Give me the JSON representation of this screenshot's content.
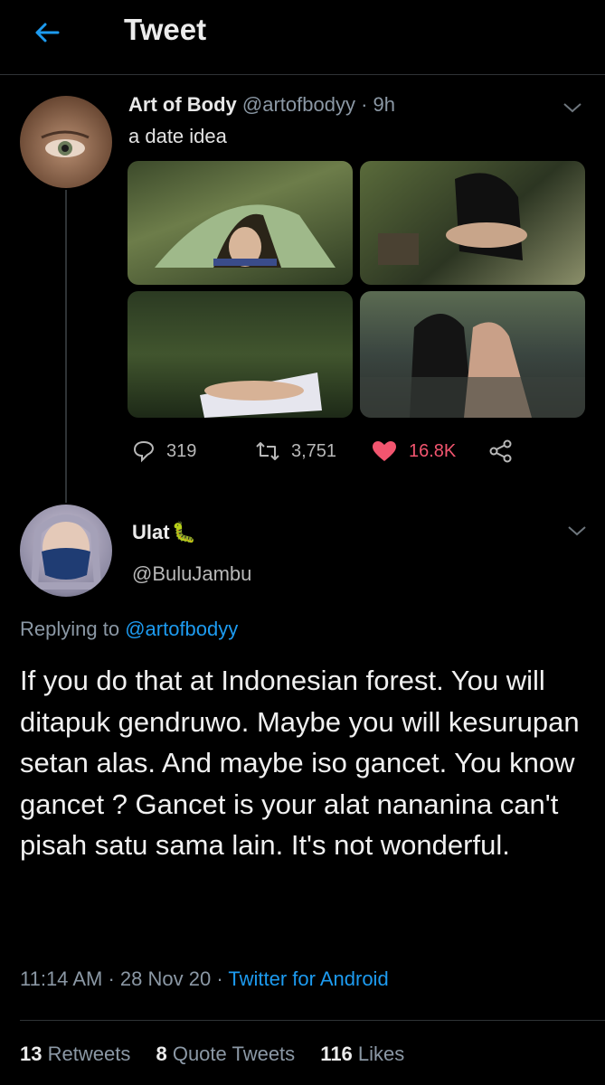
{
  "header": {
    "title": "Tweet"
  },
  "original_tweet": {
    "name": "Art of Body",
    "handle": "@artofbodyy",
    "separator": "·",
    "time": "9h",
    "text": "a date idea",
    "replies": "319",
    "retweets": "3,751",
    "likes": "16.8K"
  },
  "reply_tweet": {
    "name": "Ulat",
    "name_emoji": "🐛",
    "handle": "@BuluJambu",
    "replying_prefix": "Replying to",
    "replying_mention": "@artofbodyy",
    "text": "If you do that at Indonesian forest. You will ditapuk gendruwo. Maybe you will kesurupan setan alas. And maybe iso gancet. You know gancet ? Gancet is your alat nananina can't pisah satu sama lain. It's not wonderful.",
    "time": "11:14 AM",
    "date": "28 Nov 20",
    "source": "Twitter for Android",
    "retweets_count": "13",
    "retweets_label": "Retweets",
    "quote_count": "8",
    "quote_label": "Quote Tweets",
    "likes_count": "116",
    "likes_label": "Likes"
  },
  "colors": {
    "accent": "#1d9bf0",
    "like": "#f2556f",
    "background": "#000000"
  },
  "icons": [
    "back-arrow-icon",
    "chevron-down-icon",
    "reply-icon",
    "retweet-icon",
    "heart-icon",
    "share-icon"
  ]
}
